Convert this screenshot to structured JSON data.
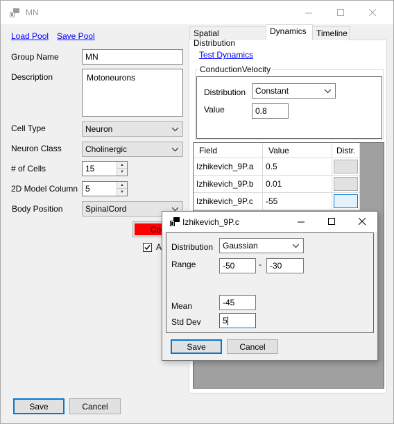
{
  "window": {
    "title": "MN"
  },
  "toolbar": {
    "load_pool": "Load Pool",
    "save_pool": "Save Pool"
  },
  "form": {
    "group_name_label": "Group Name",
    "group_name_value": "MN",
    "description_label": "Description",
    "description_value": "Motoneurons",
    "cell_type_label": "Cell Type",
    "cell_type_value": "Neuron",
    "neuron_class_label": "Neuron Class",
    "neuron_class_value": "Cholinergic",
    "num_cells_label": "# of Cells",
    "num_cells_value": "15",
    "model_column_label": "2D Model Column",
    "model_column_value": "5",
    "body_position_label": "Body Position",
    "body_position_value": "SpinalCord",
    "color_button_label": "Color",
    "color_value": "#ff0000",
    "checkbox_label": "A",
    "checkbox_checked": true
  },
  "footer": {
    "save_label": "Save",
    "cancel_label": "Cancel"
  },
  "tabs": [
    {
      "label": "Spatial Distribution",
      "active": false
    },
    {
      "label": "Dynamics",
      "active": true
    },
    {
      "label": "Timeline",
      "active": false
    }
  ],
  "dynamics": {
    "test_link": "Test Dynamics",
    "group_title": "ConductionVelocity",
    "distribution_label": "Distribution",
    "distribution_value": "Constant",
    "value_label": "Value",
    "value_value": "0.8",
    "grid": {
      "headers": [
        "Field",
        "Value",
        "Distr."
      ],
      "rows": [
        {
          "field": "Izhikevich_9P.a",
          "value": "0.5"
        },
        {
          "field": "Izhikevich_9P.b",
          "value": "0.01"
        },
        {
          "field": "Izhikevich_9P.c",
          "value": "-55"
        }
      ]
    }
  },
  "dialog": {
    "title": "Izhikevich_9P.c",
    "distribution_label": "Distribution",
    "distribution_value": "Gaussian",
    "range_label": "Range",
    "range_min": "-50",
    "range_sep": "-",
    "range_max": "-30",
    "mean_label": "Mean",
    "mean_value": "-45",
    "std_label": "Std Dev",
    "std_value": "5",
    "save_label": "Save",
    "cancel_label": "Cancel"
  },
  "colors": {
    "accent": "#0078d7",
    "grid_background": "#a0a0a0",
    "link": "#0000ff"
  }
}
